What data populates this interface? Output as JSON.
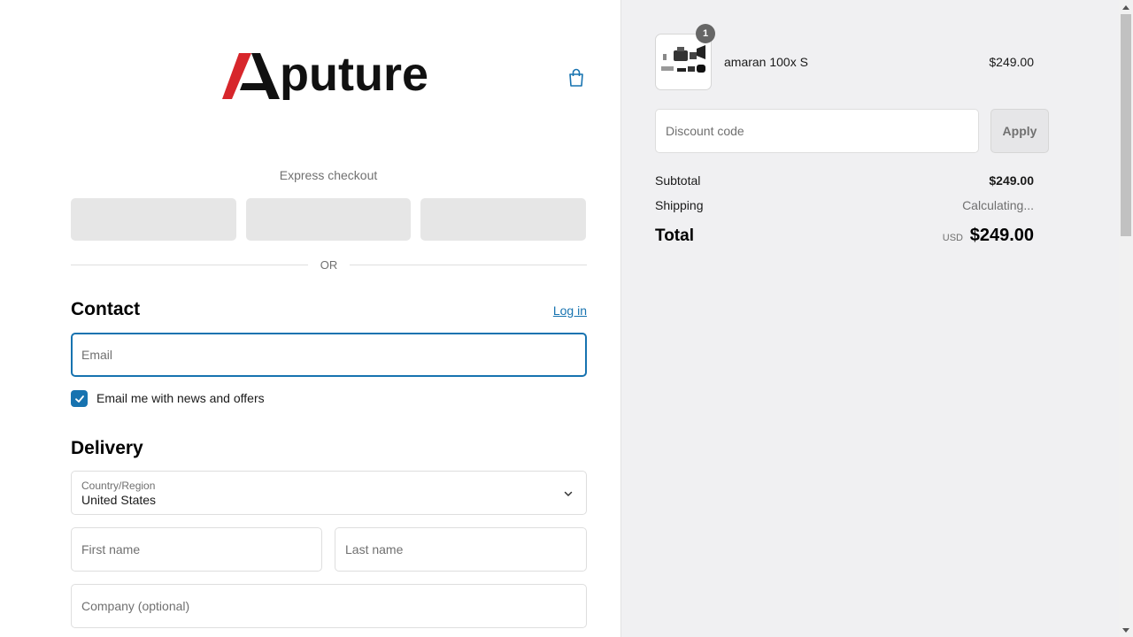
{
  "brand": {
    "logo_text": "Aputure",
    "accent": "#1773b0",
    "logo_red": "#d7262b"
  },
  "header": {
    "cart_icon": "shopping-bag-icon"
  },
  "express": {
    "label": "Express checkout",
    "buttons": [
      "",
      "",
      ""
    ]
  },
  "divider": {
    "or_text": "OR"
  },
  "contact": {
    "title": "Contact",
    "login_label": "Log in",
    "email_placeholder": "Email",
    "newsletter_label": "Email me with news and offers",
    "newsletter_checked": true
  },
  "delivery": {
    "title": "Delivery",
    "country_label": "Country/Region",
    "country_value": "United States",
    "first_name_placeholder": "First name",
    "last_name_placeholder": "Last name",
    "company_placeholder": "Company (optional)"
  },
  "summary": {
    "product": {
      "name": "amaran 100x S",
      "price": "$249.00",
      "quantity": "1"
    },
    "discount_placeholder": "Discount code",
    "apply_label": "Apply",
    "subtotal_label": "Subtotal",
    "subtotal_value": "$249.00",
    "shipping_label": "Shipping",
    "shipping_value": "Calculating...",
    "total_label": "Total",
    "total_currency": "USD",
    "total_value": "$249.00"
  }
}
